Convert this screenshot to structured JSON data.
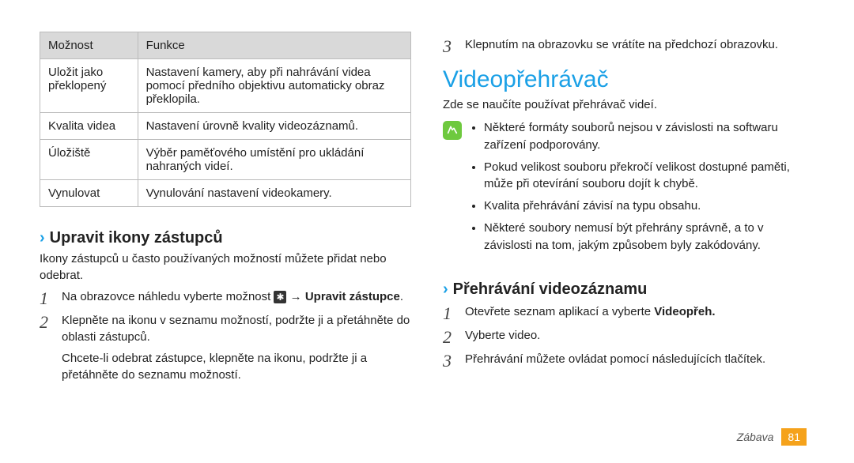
{
  "table": {
    "headers": [
      "Možnost",
      "Funkce"
    ],
    "rows": [
      [
        "Uložit jako překlopený",
        "Nastavení kamery, aby při nahrávání videa pomocí předního objektivu automaticky obraz překlopila."
      ],
      [
        "Kvalita videa",
        "Nastavení úrovně kvality videozáznamů."
      ],
      [
        "Úložiště",
        "Výběr paměťového umístění pro ukládání nahraných videí."
      ],
      [
        "Vynulovat",
        "Vynulování nastavení videokamery."
      ]
    ]
  },
  "left_section": {
    "title": "Upravit ikony zástupců",
    "intro": "Ikony zástupců u často používaných možností můžete přidat nebo odebrat.",
    "step1_pre": "Na obrazovce náhledu vyberte možnost ",
    "step1_arrow": " → ",
    "step1_bold": "Upravit zástupce",
    "step1_post": ".",
    "step2": "Klepněte na ikonu v seznamu možností, podržte ji a přetáhněte do oblasti zástupců.",
    "step2_sub": "Chcete-li odebrat zástupce, klepněte na ikonu, podržte ji a přetáhněte do seznamu možností."
  },
  "right_top": {
    "step3": "Klepnutím na obrazovku se vrátíte na předchozí obrazovku."
  },
  "video": {
    "title": "Videopřehrávač",
    "intro": "Zde se naučíte používat přehrávač videí.",
    "notes": [
      "Některé formáty souborů nejsou v závislosti na softwaru zařízení podporovány.",
      "Pokud velikost souboru překročí velikost dostupné paměti, může při otevírání souboru dojít k chybě.",
      "Kvalita přehrávání závisí na typu obsahu.",
      "Některé soubory nemusí být přehrány správně, a to v závislosti na tom, jakým způsobem byly zakódovány."
    ]
  },
  "playback": {
    "title": "Přehrávání videozáznamu",
    "step1_pre": "Otevřete seznam aplikací a vyberte ",
    "step1_bold": "Videopřeh.",
    "step2": "Vyberte video.",
    "step3": "Přehrávání můžete ovládat pomocí následujících tlačítek."
  },
  "footer": {
    "label": "Zábava",
    "page": "81"
  }
}
